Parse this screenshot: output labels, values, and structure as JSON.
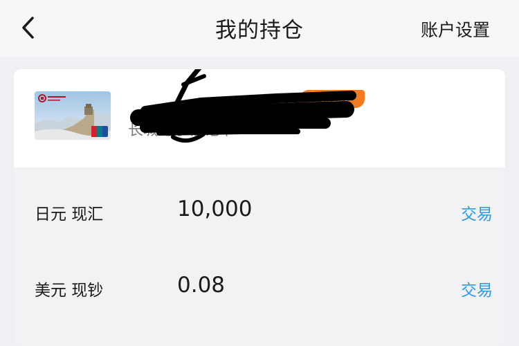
{
  "header": {
    "title": "我的持仓",
    "settings_label": "账户设置",
    "back_icon": "chevron-left-icon"
  },
  "account": {
    "badge": "交易账户",
    "card_name": "长城电子借记卡",
    "card_image": "bank-card-great-wall-image"
  },
  "holdings": [
    {
      "currency": "日元 现汇",
      "amount": "10,000",
      "action": "交易"
    },
    {
      "currency": "美元 现钞",
      "amount": "0.08",
      "action": "交易"
    }
  ],
  "colors": {
    "link": "#2b9be0",
    "badge": "#f47b20",
    "background": "#efeff4"
  }
}
